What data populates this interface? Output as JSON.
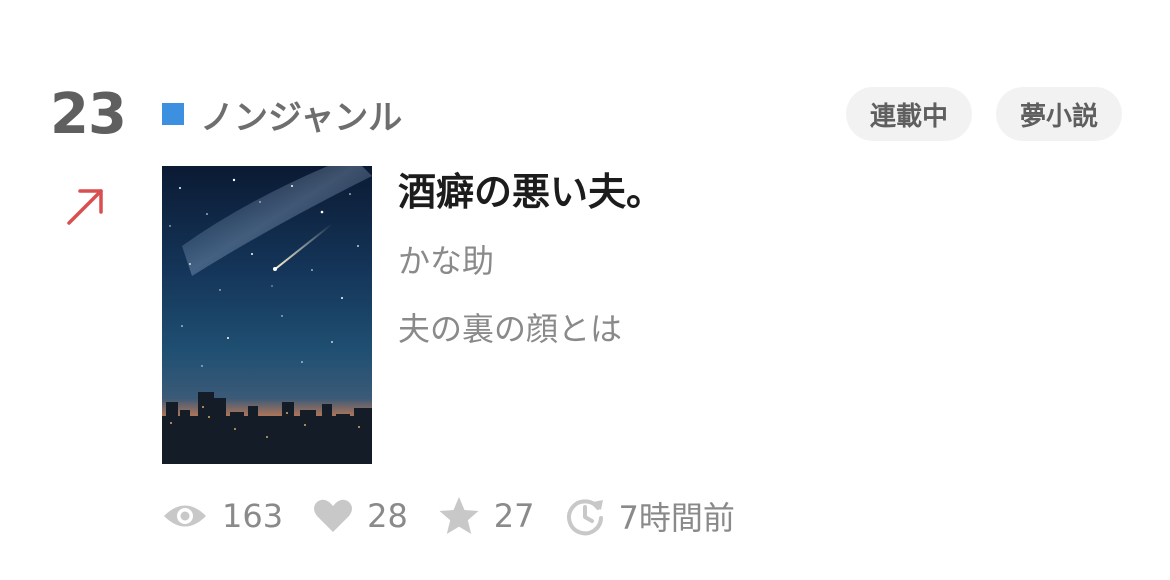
{
  "ranking": {
    "rank": "23",
    "trend_icon": "arrow-up-right-icon",
    "trend_color": "#d94f4f"
  },
  "genre": {
    "label": "ノンジャンル",
    "color": "#3d8fe0"
  },
  "tags": [
    {
      "label": "連載中"
    },
    {
      "label": "夢小説"
    }
  ],
  "book": {
    "title": "酒癖の悪い夫。",
    "author": "かな助",
    "summary": "夫の裏の顔とは",
    "cover_icon": "night-sky-city-cover"
  },
  "stats": {
    "views": "163",
    "likes": "28",
    "stars": "27",
    "updated": "7時間前"
  },
  "colors": {
    "stat_icon": "#c8c8c8",
    "tag_bg": "#f2f2f2"
  }
}
